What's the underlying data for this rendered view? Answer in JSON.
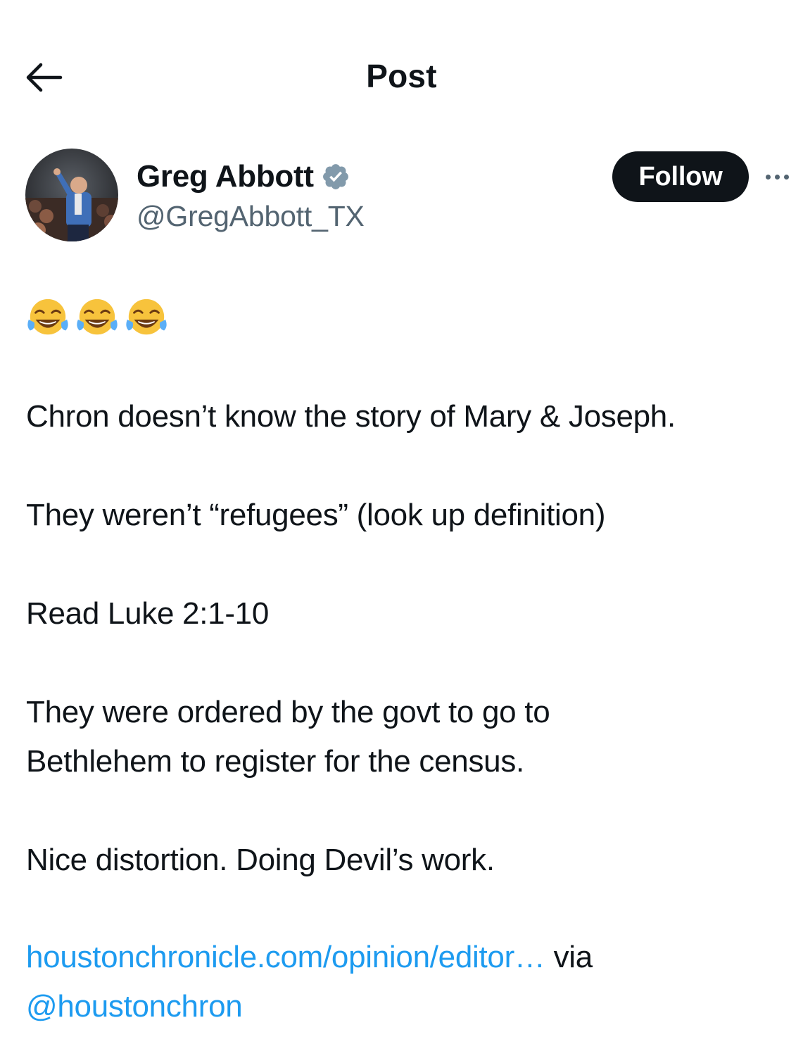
{
  "header": {
    "title": "Post"
  },
  "author": {
    "name": "Greg Abbott",
    "handle": "@GregAbbott_TX",
    "follow_label": "Follow"
  },
  "post": {
    "emojis": [
      "face-with-tears-of-joy",
      "face-with-tears-of-joy",
      "face-with-tears-of-joy"
    ],
    "paragraphs": [
      "Chron doesn’t know the story of Mary & Joseph.",
      "They weren’t “refugees” (look up definition)",
      "Read Luke 2:1-10",
      "They were ordered by the govt to go to",
      "Bethlehem to register for the census.",
      "Nice distortion. Doing Devil’s work."
    ],
    "link_text": "houstonchronicle.com/opinion/editor…",
    "via_text": " via",
    "mention": "@houstonchron"
  },
  "colors": {
    "text": "#0f1419",
    "secondary": "#536471",
    "link": "#1d9bf0",
    "follow_bg": "#0f1419",
    "verified_badge": "#829aab"
  }
}
